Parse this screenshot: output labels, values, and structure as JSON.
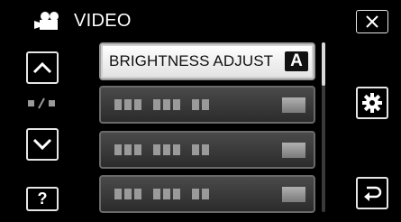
{
  "header": {
    "title": "VIDEO",
    "mode_icon": "video-camera-icon"
  },
  "nav": {
    "up_icon": "chevron-up-icon",
    "down_icon": "chevron-down-icon",
    "page_indicator_icon": "page-indicator-icon",
    "help_label": "?"
  },
  "menu": {
    "items": [
      {
        "label": "BRIGHTNESS ADJUST",
        "badge": "A",
        "enabled": true
      },
      {
        "label": "",
        "enabled": false
      },
      {
        "label": "",
        "enabled": false
      },
      {
        "label": "",
        "enabled": false
      }
    ]
  },
  "side": {
    "close_icon": "close-icon",
    "settings_icon": "gear-icon",
    "back_icon": "return-icon"
  },
  "colors": {
    "background": "#000000",
    "selected_item": "#ffffff",
    "disabled_item": "#3a3a3a",
    "border": "#e6e6e6"
  }
}
